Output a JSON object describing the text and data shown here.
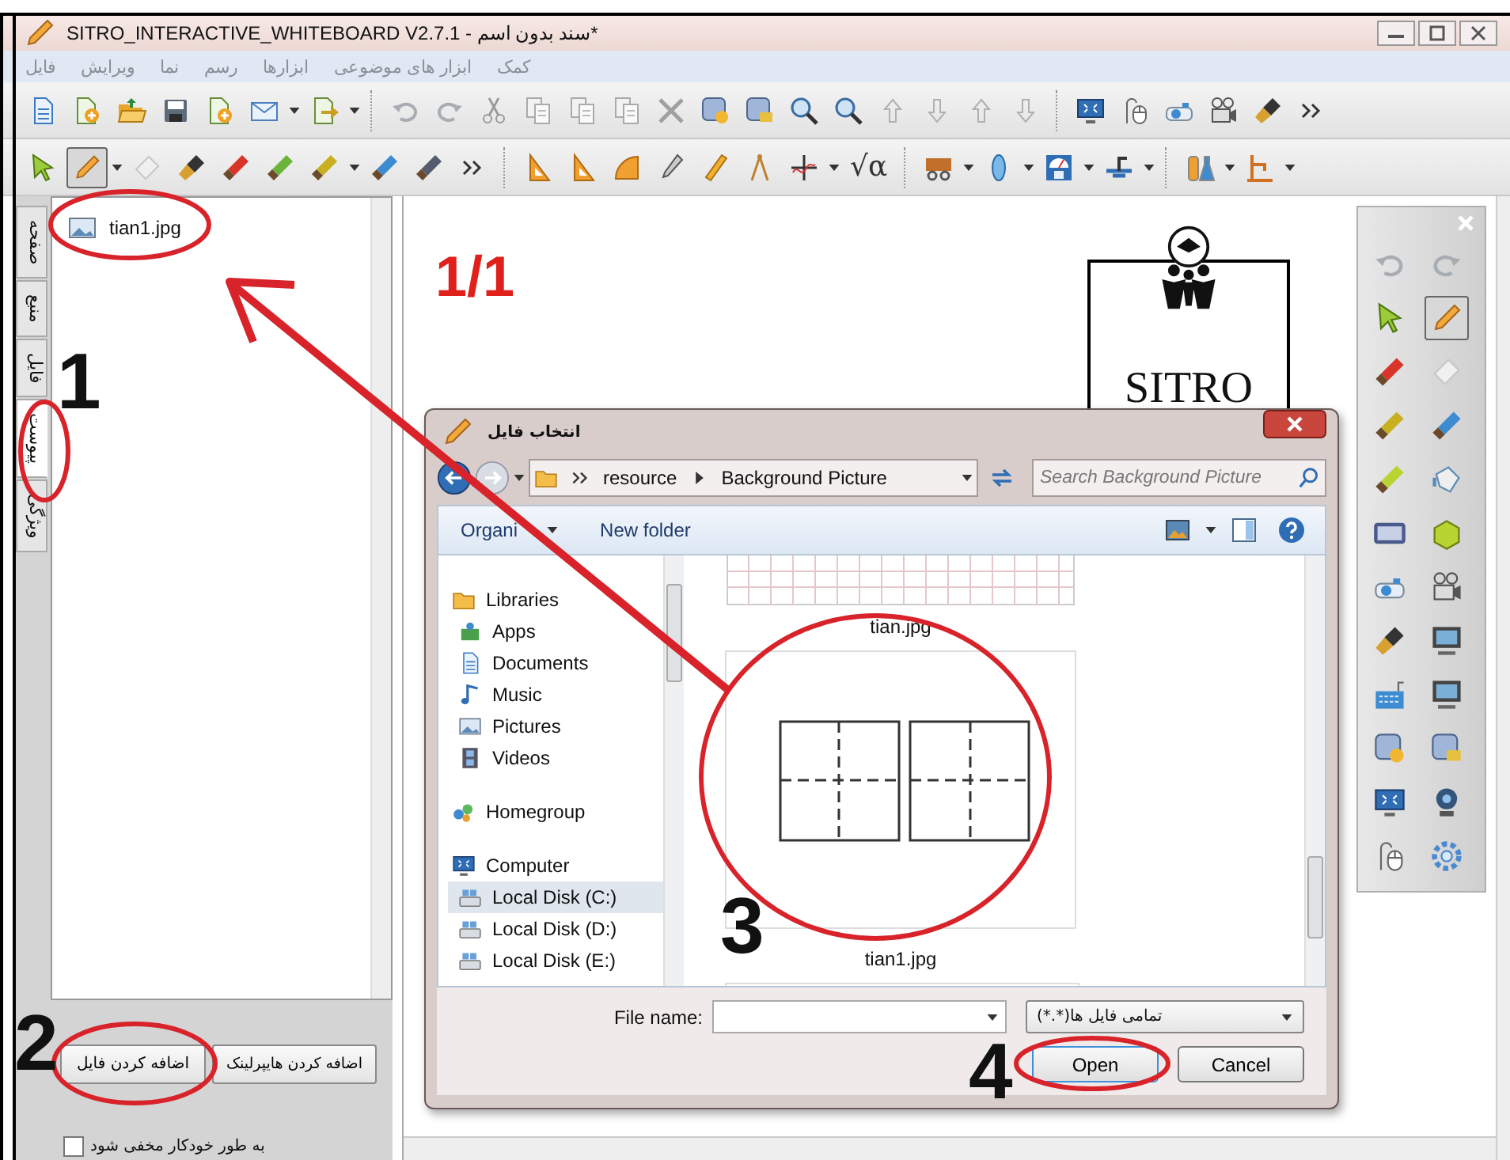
{
  "window": {
    "title": "SITRO_INTERACTIVE_WHITEBOARD V2.7.1 - سند بدون اسم*"
  },
  "menu": {
    "file": "فایل",
    "edit": "ویرایش",
    "view": "نما",
    "draw": "رسم",
    "tools": "ابزارها",
    "subject_tools": "ابزار های موضوعی",
    "help": "کمک"
  },
  "toolbar_2": {
    "pen_selected": true,
    "formula_button": "√α"
  },
  "side_tabs": [
    {
      "label": "صفحه",
      "selected": false
    },
    {
      "label": "منبع",
      "selected": false
    },
    {
      "label": "فایل",
      "selected": false
    },
    {
      "label": "پیوست",
      "selected": true
    },
    {
      "label": "ویژگی",
      "selected": false
    }
  ],
  "attachments": {
    "items": [
      "tian1.jpg"
    ],
    "add_file_button": "اضافه کردن فایل",
    "add_hyperlink_button": "اضافه کردن هایپرلینک",
    "auto_hide": {
      "label": "به طور خودکار مخفی شود",
      "checked": false
    }
  },
  "canvas": {
    "page_label": "1/1",
    "logo_text": "SITRO"
  },
  "side_toolbar": {
    "pen_selected": true
  },
  "dialog": {
    "title": "انتخاب فایل",
    "path": {
      "parent": "resource",
      "current": "Background Picture"
    },
    "search_placeholder": "Search Background Picture",
    "organize_menu": "Organi",
    "new_folder_button": "New folder",
    "nav": [
      {
        "label": "Libraries",
        "selected": false,
        "children": [
          {
            "label": "Apps",
            "selected": false
          },
          {
            "label": "Documents",
            "selected": false
          },
          {
            "label": "Music",
            "selected": false
          },
          {
            "label": "Pictures",
            "selected": false
          },
          {
            "label": "Videos",
            "selected": false
          }
        ]
      },
      {
        "label": "Homegroup",
        "selected": false
      },
      {
        "label": "Computer",
        "selected": false,
        "children": [
          {
            "label": "Local Disk (C:)",
            "selected": true
          },
          {
            "label": "Local Disk (D:)",
            "selected": false
          },
          {
            "label": "Local Disk (E:)",
            "selected": false
          }
        ]
      }
    ],
    "files": [
      {
        "label": "tian.jpg",
        "kind": "grid"
      },
      {
        "label": "tian1.jpg",
        "kind": "boxes"
      }
    ],
    "file_name_label": "File name:",
    "filter": "تمامی فایل ها(*.*)",
    "open_button": "Open",
    "cancel_button": "Cancel"
  },
  "annotations": {
    "steps": [
      "1",
      "2",
      "3",
      "4"
    ]
  }
}
